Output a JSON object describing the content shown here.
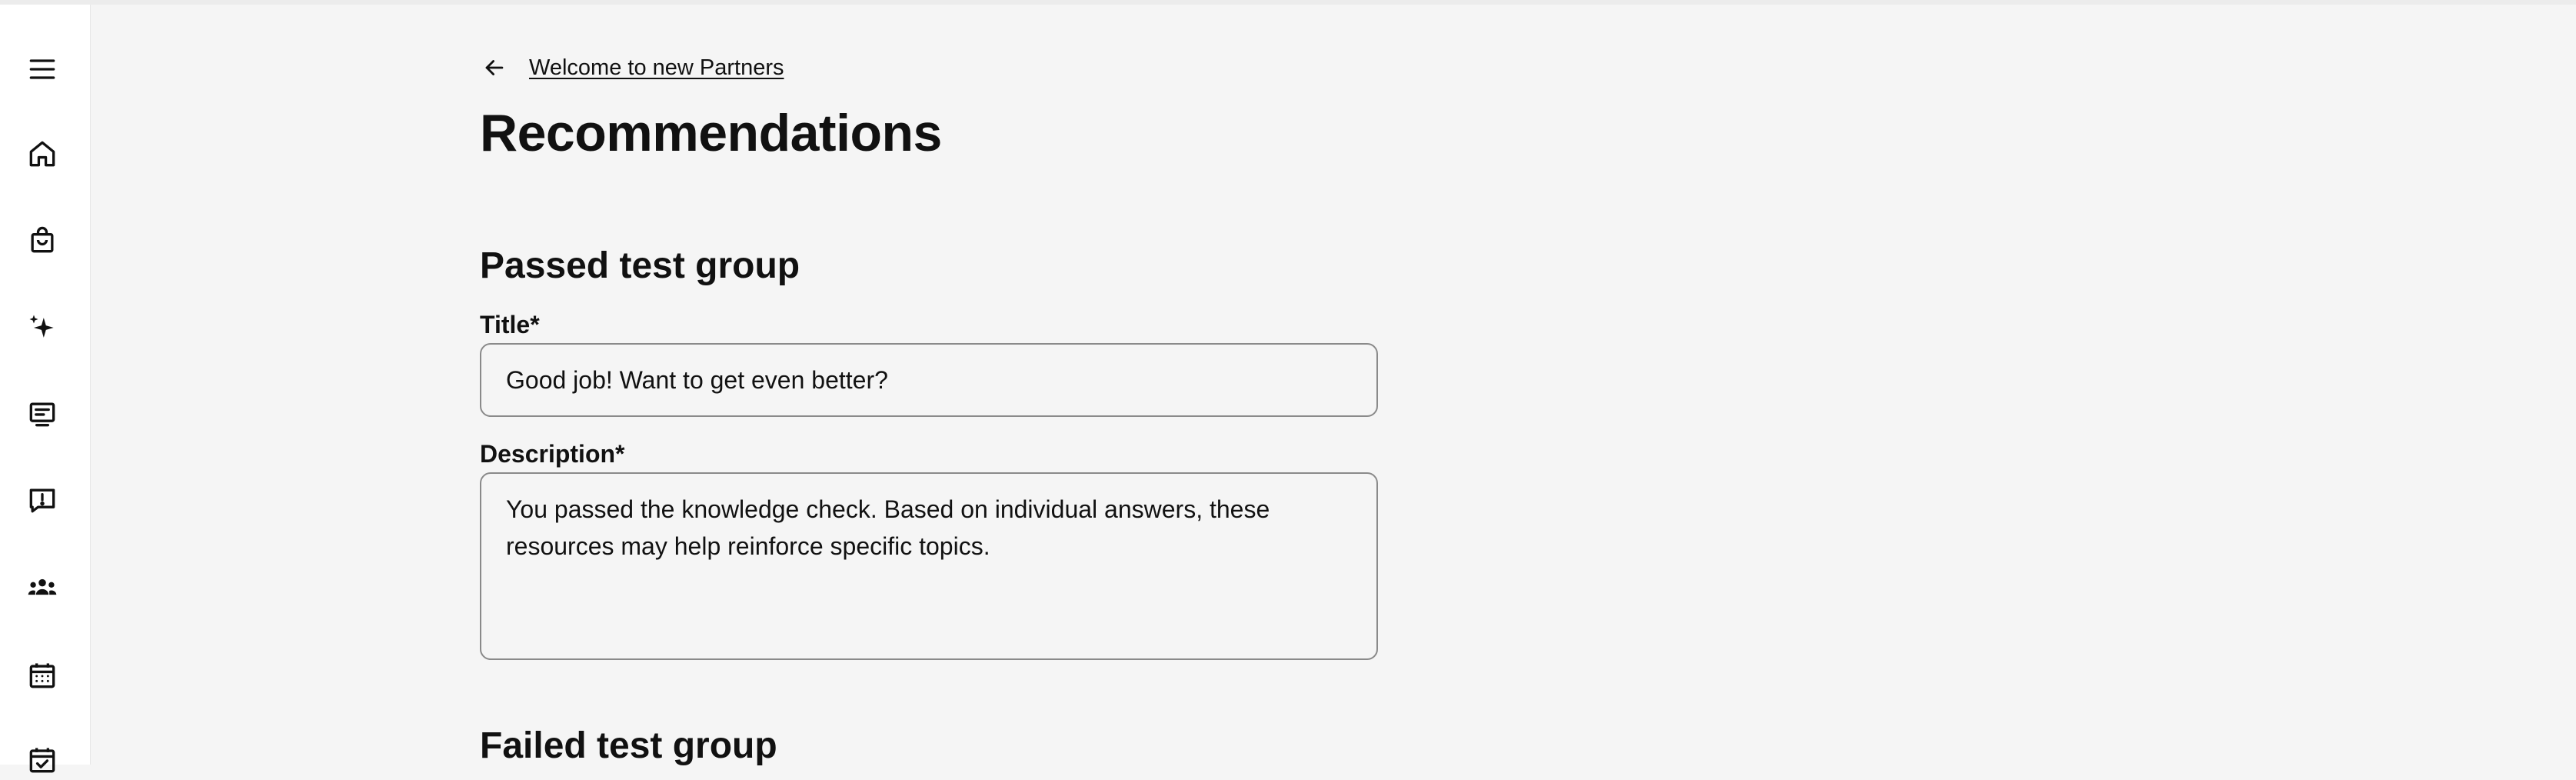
{
  "sidebar": {
    "icons": [
      {
        "name": "menu-icon"
      },
      {
        "name": "home-icon"
      },
      {
        "name": "shopping-bag-icon"
      },
      {
        "name": "sparkle-icon"
      },
      {
        "name": "monitor-icon"
      },
      {
        "name": "feedback-icon"
      },
      {
        "name": "people-icon"
      },
      {
        "name": "calendar-icon"
      },
      {
        "name": "calendar-check-icon"
      }
    ]
  },
  "header": {
    "back_link": "Welcome to new Partners",
    "back_icon": "arrow-left-icon",
    "title": "Recommendations"
  },
  "passed_group": {
    "heading": "Passed test group",
    "title_label": "Title*",
    "title_value": "Good job! Want to get even better?",
    "description_label": "Description*",
    "description_value": "You passed the knowledge check. Based on individual answers, these resources may help reinforce specific topics."
  },
  "failed_group": {
    "heading": "Failed test group"
  }
}
